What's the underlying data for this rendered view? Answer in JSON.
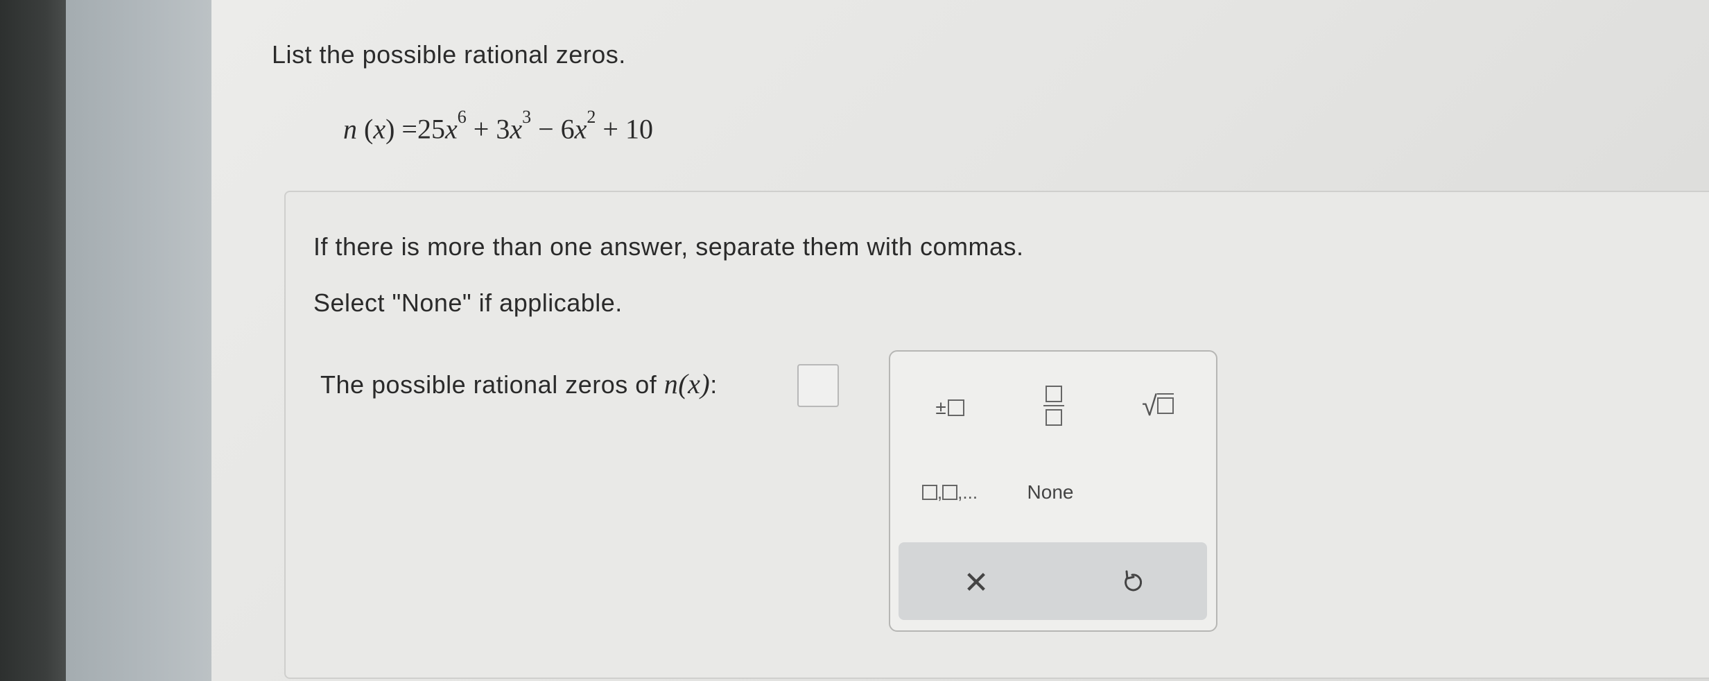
{
  "question": {
    "prompt": "List the possible rational zeros.",
    "equation": {
      "func": "n",
      "arg": "x",
      "rhs": {
        "t1_coef": "25",
        "t1_var": "x",
        "t1_exp": "6",
        "t2_coef": "3",
        "t2_var": "x",
        "t2_exp": "3",
        "t3_coef": "6",
        "t3_var": "x",
        "t3_exp": "2",
        "t4_const": "10"
      }
    }
  },
  "answer": {
    "instruction_1": "If there is more than one answer, separate them with commas.",
    "instruction_2": "Select \"None\" if applicable.",
    "label_prefix": "The possible rational zeros of",
    "label_func": "n",
    "label_arg": "x",
    "input_value": ""
  },
  "palette": {
    "plus_minus_symbol": "±",
    "list_label": ",   ,...",
    "none_label": "None",
    "clear_symbol": "✕",
    "undo_icon": "undo-icon"
  }
}
